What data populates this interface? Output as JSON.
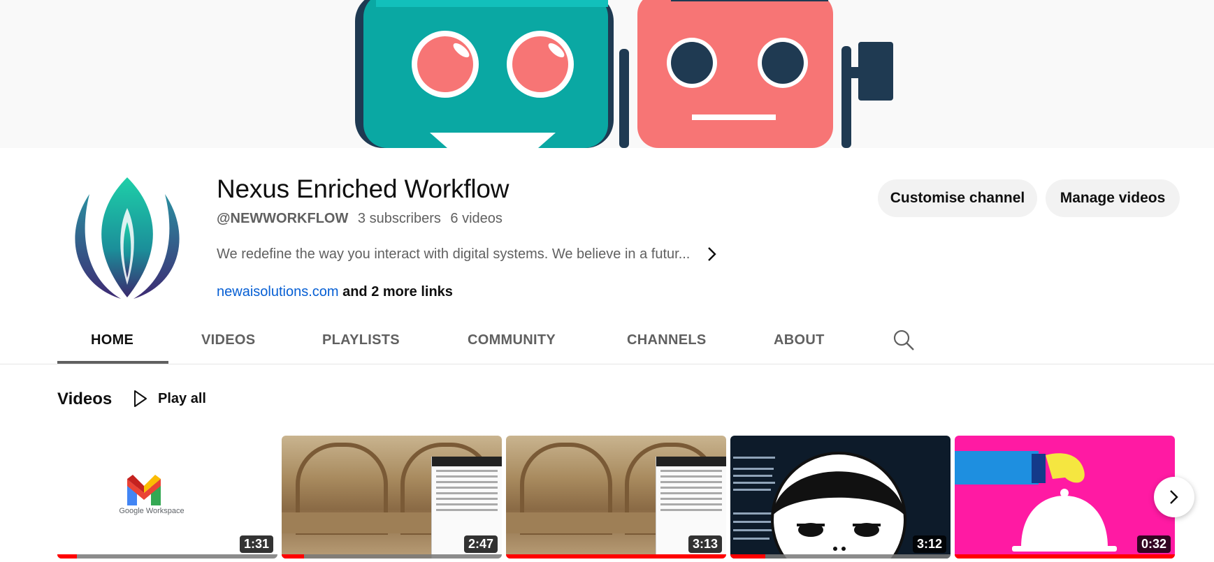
{
  "banner": {
    "name": "channel-banner"
  },
  "channel": {
    "title": "Nexus Enriched Workflow",
    "handle": "@NEWWORKFLOW",
    "subscribers": "3 subscribers",
    "videos_count": "6 videos",
    "description": "We redefine the way you interact with digital systems. We believe in a futur...",
    "link": "newaisolutions.com",
    "more_links": "and 2 more links"
  },
  "actions": {
    "customise": "Customise channel",
    "manage": "Manage videos"
  },
  "tabs": [
    {
      "label": "HOME",
      "active": true
    },
    {
      "label": "VIDEOS"
    },
    {
      "label": "PLAYLISTS"
    },
    {
      "label": "COMMUNITY"
    },
    {
      "label": "CHANNELS"
    },
    {
      "label": "ABOUT"
    }
  ],
  "section": {
    "title": "Videos",
    "play_all": "Play all"
  },
  "videos": [
    {
      "duration": "1:31",
      "brand": "Google Workspace",
      "watched": 0.09
    },
    {
      "duration": "2:47",
      "watched": 0.1
    },
    {
      "duration": "3:13",
      "watched": 1.0
    },
    {
      "duration": "3:12",
      "watched": 0.16
    },
    {
      "duration": "0:32",
      "watched": 1.0
    }
  ],
  "colors": {
    "accent": "#ff0000",
    "link": "#065fd4",
    "robot_teal": "#0aa8a3",
    "robot_coral": "#f77575",
    "robot_navy": "#1f3a52",
    "pink_thumb": "#ff1aa3"
  }
}
